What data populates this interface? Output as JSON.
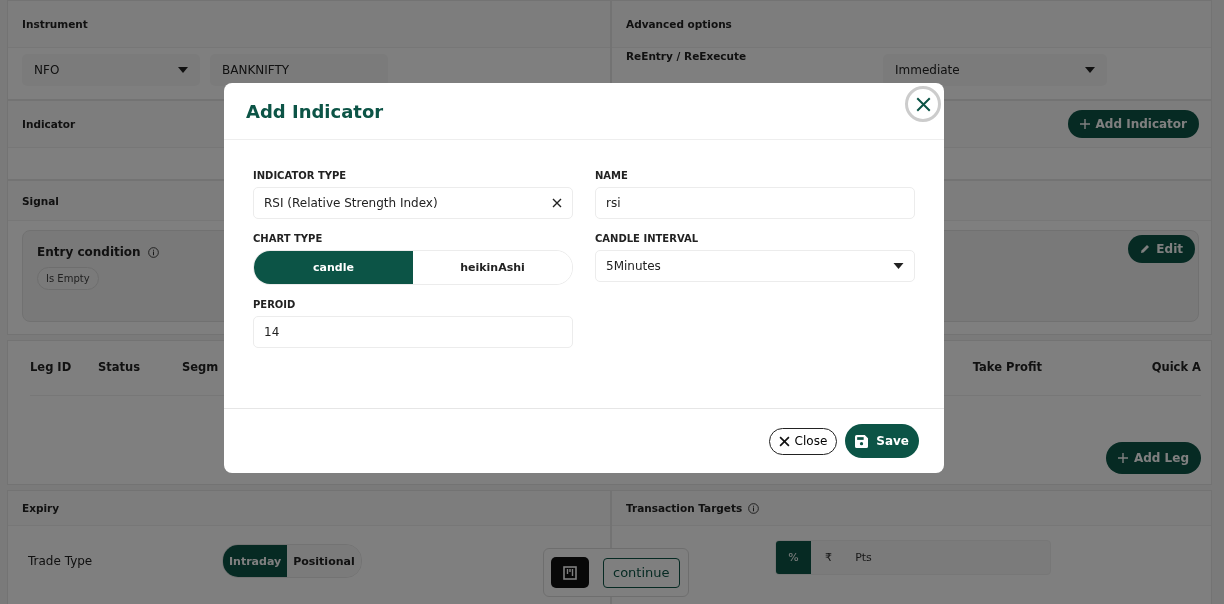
{
  "instrument": {
    "title": "Instrument",
    "exchange": "NFO",
    "symbol": "BANKNIFTY"
  },
  "advanced_options": {
    "title": "Advanced options",
    "reentry_label": "ReEntry / ReExecute",
    "reentry_value": "Immediate"
  },
  "indicator_section": {
    "title": "Indicator",
    "add_button": "Add Indicator"
  },
  "signal": {
    "title": "Signal",
    "entry_condition": "Entry condition",
    "condition_chip": "Is Empty",
    "edit_button": "Edit"
  },
  "legs_table": {
    "columns": [
      "Leg ID",
      "Status",
      "Segm",
      "Take Profit",
      "Quick A"
    ],
    "add_button": "Add Leg"
  },
  "expiry": {
    "title": "Expiry",
    "trade_type_label": "Trade Type",
    "trade_types": [
      {
        "label": "Intraday",
        "selected": true
      },
      {
        "label": "Positional",
        "selected": false
      }
    ]
  },
  "transaction_targets": {
    "title": "Transaction Targets",
    "units": [
      {
        "label": "%",
        "selected": true
      },
      {
        "label": "₹",
        "selected": false
      },
      {
        "label": "Pts",
        "selected": false
      }
    ]
  },
  "floating_toolbar": {
    "continue_button": "continue"
  },
  "modal": {
    "title": "Add Indicator",
    "indicator_type": {
      "label": "INDICATOR TYPE",
      "value": "RSI (Relative Strength Index)"
    },
    "name": {
      "label": "NAME",
      "value": "rsi"
    },
    "chart_type": {
      "label": "CHART TYPE",
      "options": [
        {
          "label": "candle",
          "selected": true
        },
        {
          "label": "heikinAshi",
          "selected": false
        }
      ]
    },
    "candle_interval": {
      "label": "CANDLE INTERVAL",
      "value": "5Minutes"
    },
    "period": {
      "label": "PEROID",
      "value": "14"
    },
    "close_button": "Close",
    "save_button": "Save"
  }
}
